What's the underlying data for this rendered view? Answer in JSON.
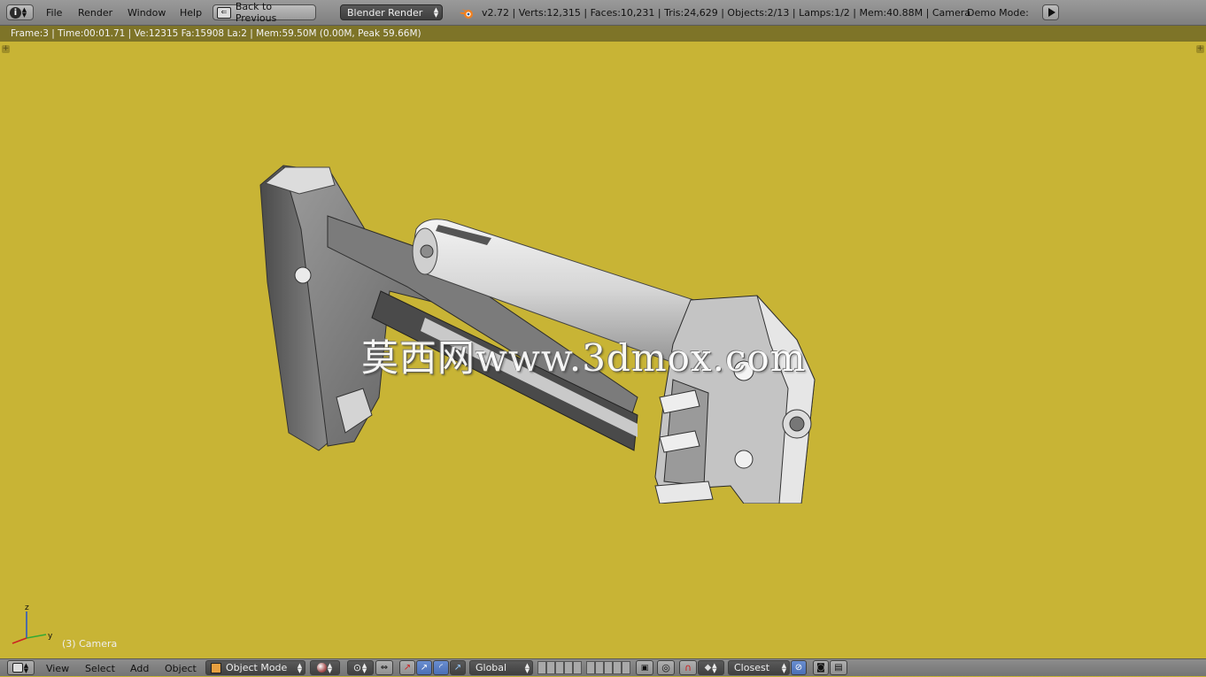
{
  "topbar": {
    "editor_icon": "info-icon",
    "menus": [
      "File",
      "Render",
      "Window",
      "Help"
    ],
    "back_button": "Back to Previous",
    "render_engine": "Blender Render",
    "stats": "v2.72 | Verts:12,315 | Faces:10,231 | Tris:24,629 | Objects:2/13 | Lamps:1/2 | Mem:40.88M | Camera",
    "demo_mode_label": "Demo Mode:",
    "play_icon": "play-icon",
    "blender_logo": "blender-logo-icon"
  },
  "viewport": {
    "frame_info": "Frame:3 | Time:00:01.71 | Ve:12315 Fa:15908 La:2 | Mem:59.50M (0.00M, Peak 59.66M)",
    "background_color": "#c8b435",
    "watermark": "莫西网www.3dmox.com",
    "object_label": "(3) Camera",
    "axis_labels": {
      "z": "z",
      "y": "y"
    }
  },
  "bottombar": {
    "editor_icon": "3d-view-icon",
    "menus": [
      "View",
      "Select",
      "Add",
      "Object"
    ],
    "mode": "Object Mode",
    "transform_orientation": "Global",
    "snap_target": "Closest"
  }
}
